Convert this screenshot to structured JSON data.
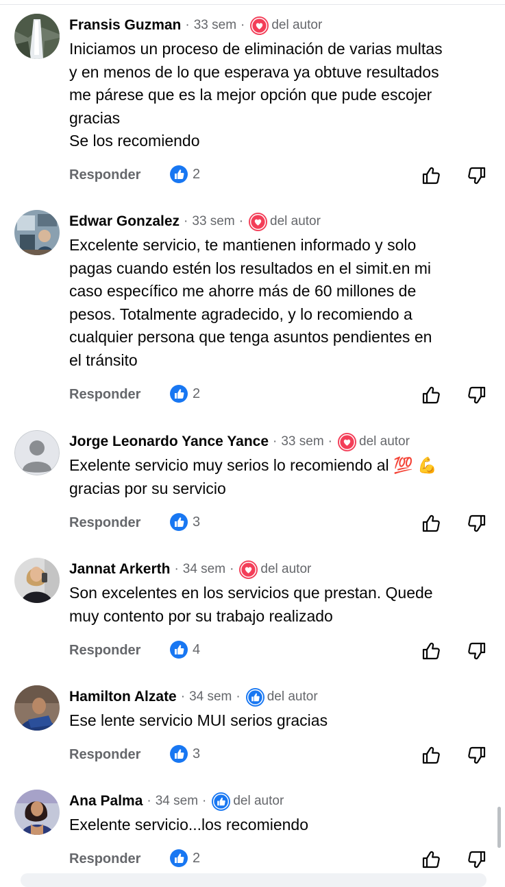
{
  "comments": [
    {
      "author": "Fransis Guzman",
      "time": "33 sem",
      "badge_label": "del autor",
      "badge_icon": "heart-icon",
      "text_lines": [
        "Iniciamos un proceso de eliminación de varias multas",
        "y en menos de lo que esperava ya obtuve resultados",
        "me párese que es la mejor opción que pude escojer",
        "gracias",
        "Se los recomiendo"
      ],
      "reply_label": "Responder",
      "like_count": "2"
    },
    {
      "author": "Edwar Gonzalez",
      "time": "33 sem",
      "badge_label": "del autor",
      "badge_icon": "heart-icon",
      "text_lines": [
        "Excelente servicio, te mantienen informado y solo",
        "pagas cuando estén los resultados en el simit.en mi",
        "caso específico me ahorre más de 60 millones de",
        "pesos. Totalmente agradecido, y lo recomiendo a",
        "cualquier persona que tenga asuntos pendientes en",
        "el tránsito"
      ],
      "reply_label": "Responder",
      "like_count": "2"
    },
    {
      "author": "Jorge Leonardo Yance Yance",
      "time": "33 sem",
      "badge_label": "del autor",
      "badge_icon": "heart-icon",
      "text_lines": [
        "Exelente servicio muy serios lo recomiendo al 💯 💪",
        "gracias por su servicio"
      ],
      "reply_label": "Responder",
      "like_count": "3"
    },
    {
      "author": "Jannat Arkerth",
      "time": "34 sem",
      "badge_label": "del autor",
      "badge_icon": "heart-icon",
      "text_lines": [
        "Son excelentes en los servicios que prestan. Quede",
        "muy contento por su trabajo realizado"
      ],
      "reply_label": "Responder",
      "like_count": "4"
    },
    {
      "author": "Hamilton Alzate",
      "time": "34 sem",
      "badge_label": "del autor",
      "badge_icon": "like-icon",
      "text_lines": [
        "Ese lente servicio MUI serios gracias"
      ],
      "reply_label": "Responder",
      "like_count": "3"
    },
    {
      "author": "Ana Palma",
      "time": "34 sem",
      "badge_label": "del autor",
      "badge_icon": "like-icon",
      "text_lines": [
        "Exelente servicio...los recomiendo"
      ],
      "reply_label": "Responder",
      "like_count": "2"
    }
  ],
  "colors": {
    "like_blue": "#1877f2",
    "heart_red": "#f33e58",
    "secondary_text": "#65676b"
  }
}
